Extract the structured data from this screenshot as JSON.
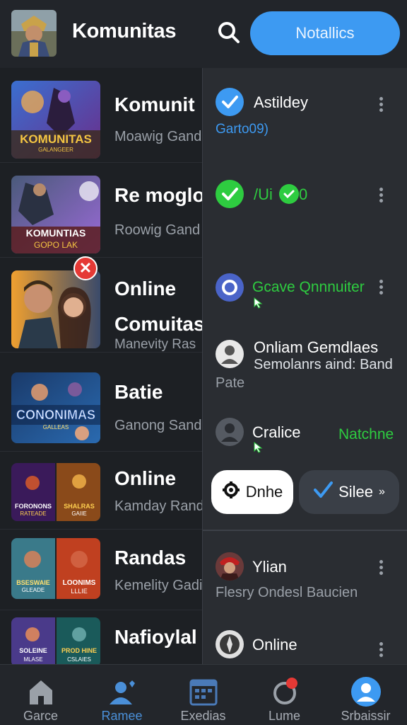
{
  "header": {
    "title": "Komunitas",
    "notifications_button": "Notallics"
  },
  "list": [
    {
      "title": "Komunit",
      "subtitle": "Moawig Gand",
      "thumb_text": [
        "KOMUNITAS",
        "GALANGEER"
      ]
    },
    {
      "title": "Re moglo",
      "subtitle": "Roowig Gand",
      "thumb_text": [
        "KOMUNTIAS",
        "GOPO LAK"
      ]
    },
    {
      "title": "Online",
      "title2": "Comuitas",
      "subtitle": "Manevity Ras"
    },
    {
      "title": "Batie",
      "subtitle": "Ganong Sand",
      "thumb_text": [
        "CONONIMAS",
        "GALLEAS"
      ]
    },
    {
      "title": "Online",
      "subtitle": "Kamday Rand",
      "thumb_text": [
        "FORONONS",
        "RATEADE",
        "SHALRAS",
        "GAIIE"
      ]
    },
    {
      "title": "Randas",
      "subtitle": "Kemelity Gadi",
      "thumb_text": [
        "BSESWAIE",
        "GLEADE",
        "LOONIMS",
        "LLLIE"
      ]
    },
    {
      "title": "Nafioylal",
      "subtitle": "",
      "thumb_text": [
        "SOLEINE",
        "MLASE",
        "PROD HINE",
        "CSLAIES"
      ]
    }
  ],
  "panel": {
    "items": [
      {
        "name": "Astildey",
        "sub": "Garto09)"
      },
      {
        "name": "/Ui",
        "badge": "0"
      },
      {
        "name": "Gcave Qnnnuiter"
      },
      {
        "name": "Onliam Gemdlaes",
        "line2": "Semolanrs aind: Band",
        "sub": "Pate"
      },
      {
        "name": "Cralice",
        "status": "Natchne"
      }
    ],
    "btn_done": "Dnhe",
    "btn_silee": "Silee",
    "lower": [
      {
        "name": "Ylian",
        "sub": "Flesry Ondesl Baucien"
      },
      {
        "name": "Online"
      }
    ]
  },
  "bottom_nav": [
    {
      "label": "Garce",
      "icon": "home-icon"
    },
    {
      "label": "Ramee",
      "icon": "people-icon"
    },
    {
      "label": "Exedias",
      "icon": "calendar-icon"
    },
    {
      "label": "Lume",
      "icon": "refresh-icon"
    },
    {
      "label": "Srbaissir",
      "icon": "profile-icon"
    }
  ],
  "colors": {
    "accent": "#3d9af2",
    "green": "#2ecc40",
    "red": "#e53935"
  }
}
